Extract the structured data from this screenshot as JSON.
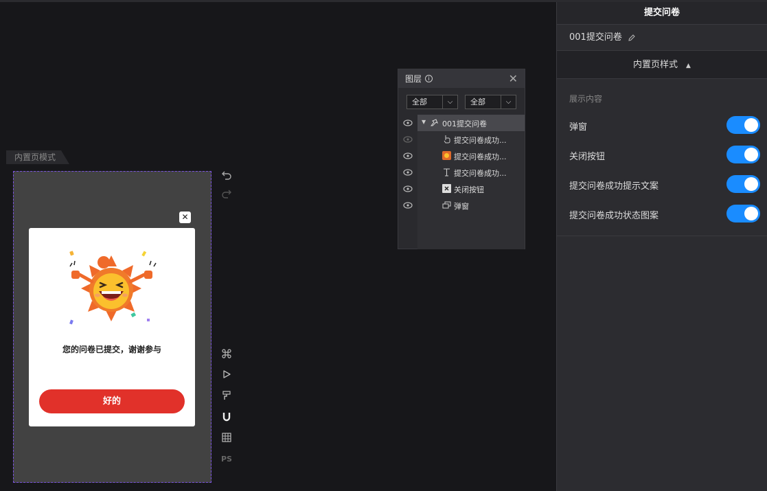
{
  "canvas": {
    "mode_tab": "内置页模式",
    "popup": {
      "close_symbol": "✕",
      "message": "您的问卷已提交，谢谢参与",
      "ok_button": "好的",
      "accent_color": "#e1312a"
    },
    "tools": [
      "undo-icon",
      "redo-icon",
      "command-icon",
      "play-icon",
      "paint-roller-icon",
      "magnet-icon",
      "grid-icon"
    ],
    "ps_label": "PS"
  },
  "layers": {
    "title": "图层",
    "filter_left": "全部",
    "filter_right": "全部",
    "root": "001提交问卷",
    "items": [
      "提交问卷成功...",
      "提交问卷成功...",
      "提交问卷成功...",
      "关闭按钮",
      "弹窗"
    ]
  },
  "right_panel": {
    "title": "提交问卷",
    "page_name": "001提交问卷",
    "section": "内置页样式",
    "subheading": "展示内容",
    "toggles": [
      {
        "label": "弹窗",
        "on": true
      },
      {
        "label": "关闭按钮",
        "on": true
      },
      {
        "label": "提交问卷成功提示文案",
        "on": true
      },
      {
        "label": "提交问卷成功状态图案",
        "on": true
      }
    ],
    "switch_color": "#1a8cff"
  }
}
